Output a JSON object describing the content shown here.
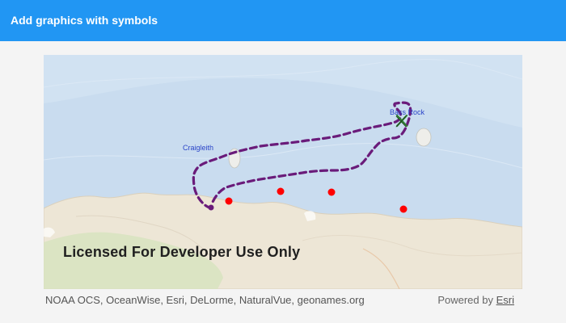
{
  "app": {
    "title": "Add graphics with symbols"
  },
  "map": {
    "labels": {
      "craigleith": "Craigleith",
      "bass_rock": "Bass Rock"
    },
    "watermark": "Licensed For Developer Use Only",
    "graphics": {
      "point_color": "#ff0000",
      "line_color": "#6a1b7a",
      "marker_color": "#2e7d32",
      "point_count": 4
    },
    "attribution": "NOAA OCS, OceanWise, Esri, DeLorme, NaturalVue, geonames.org",
    "powered_by_prefix": "Powered by",
    "powered_by_link": "Esri"
  },
  "colors": {
    "app_bar": "#2196f3",
    "water": "#c9dcef",
    "land": "#ede6d6"
  }
}
